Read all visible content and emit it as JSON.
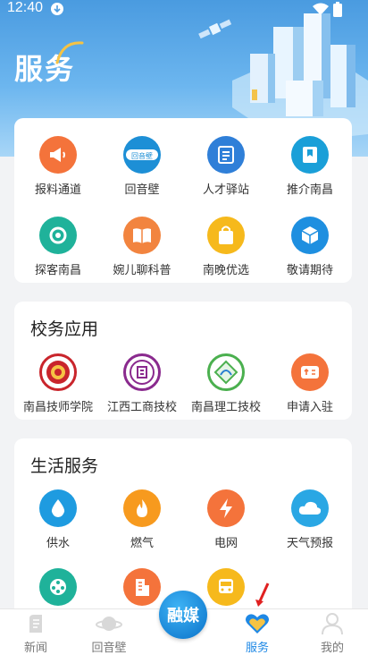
{
  "status_bar": {
    "time": "12:40"
  },
  "header": {
    "title": "服务"
  },
  "services": {
    "items": [
      {
        "label": "报料通道",
        "color": "#f4733b",
        "icon": "megaphone-icon"
      },
      {
        "label": "回音壁",
        "color": "#1d8fd6",
        "icon": "huiyinbi-logo-icon"
      },
      {
        "label": "人才驿站",
        "color": "#2f7fd8",
        "icon": "talent-station-icon"
      },
      {
        "label": "推介南昌",
        "color": "#1a9fd8",
        "icon": "bookmark-icon"
      },
      {
        "label": "探客南昌",
        "color": "#1fb29a",
        "icon": "target-icon"
      },
      {
        "label": "婉儿聊科普",
        "color": "#f2843f",
        "icon": "book-icon"
      },
      {
        "label": "南晚优选",
        "color": "#f6b91c",
        "icon": "shopping-bag-icon"
      },
      {
        "label": "敬请期待",
        "color": "#1e8fe0",
        "icon": "cube-icon"
      }
    ]
  },
  "school": {
    "title": "校务应用",
    "items": [
      {
        "label": "南昌技师学院",
        "color": "#c9252c",
        "icon": "school-emblem-icon"
      },
      {
        "label": "江西工商技校",
        "color": "#8a2a8e",
        "icon": "school-emblem-icon"
      },
      {
        "label": "南昌理工技校",
        "color": "#4bb04f",
        "icon": "school-emblem-icon"
      },
      {
        "label": "申请入驻",
        "color": "#f4733b",
        "icon": "apply-icon"
      }
    ]
  },
  "life": {
    "title": "生活服务",
    "items": [
      {
        "label": "供水",
        "color": "#1e9be0",
        "icon": "water-drop-icon"
      },
      {
        "label": "燃气",
        "color": "#f79a1e",
        "icon": "flame-icon"
      },
      {
        "label": "电网",
        "color": "#f4733b",
        "icon": "lightning-icon"
      },
      {
        "label": "天气预报",
        "color": "#2aa7e4",
        "icon": "cloud-icon"
      },
      {
        "label": "",
        "color": "#1fb29a",
        "icon": "film-reel-icon"
      },
      {
        "label": "",
        "color": "#f4733b",
        "icon": "building-icon"
      },
      {
        "label": "",
        "color": "#f6b91c",
        "icon": "bus-icon"
      }
    ]
  },
  "tabbar": {
    "tabs": [
      {
        "label": "新闻"
      },
      {
        "label": "回音壁"
      },
      {
        "label": "服务"
      },
      {
        "label": "我的"
      }
    ],
    "center_label": "融媒",
    "active_color": "#1e88e5"
  }
}
